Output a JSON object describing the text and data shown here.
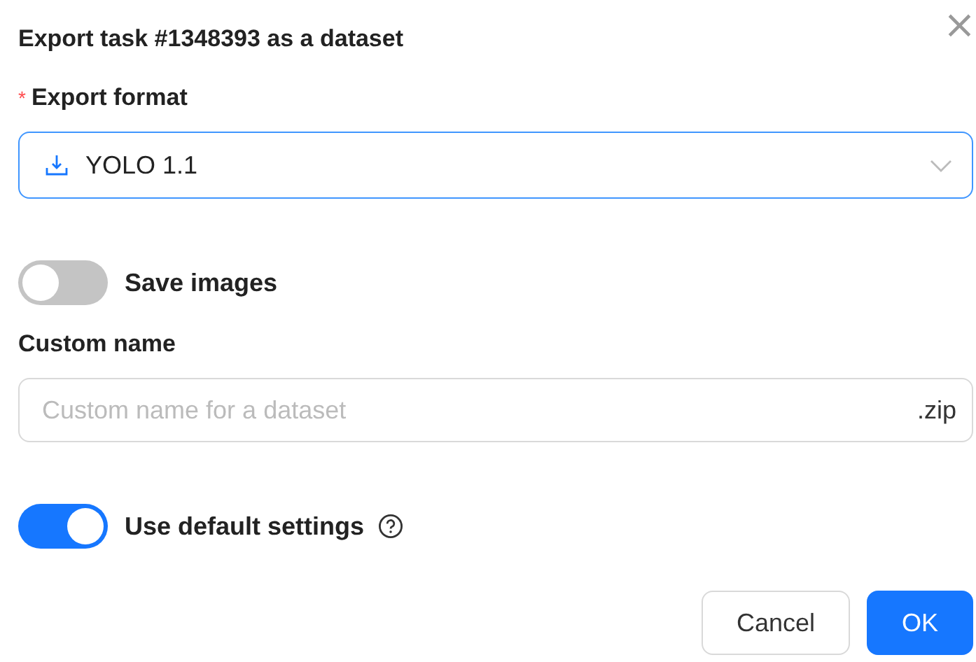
{
  "dialog": {
    "title": "Export task #1348393 as a dataset",
    "close": "×"
  },
  "export_format": {
    "label": "Export format",
    "required_mark": "*",
    "value": "YOLO 1.1"
  },
  "save_images": {
    "label": "Save images",
    "on": false
  },
  "custom_name": {
    "label": "Custom name",
    "placeholder": "Custom name for a dataset",
    "suffix": ".zip"
  },
  "use_default_settings": {
    "label": "Use default settings",
    "on": true
  },
  "buttons": [
    {
      "label": "Cancel",
      "kind": "default"
    },
    {
      "label": "OK",
      "kind": "primary"
    }
  ]
}
